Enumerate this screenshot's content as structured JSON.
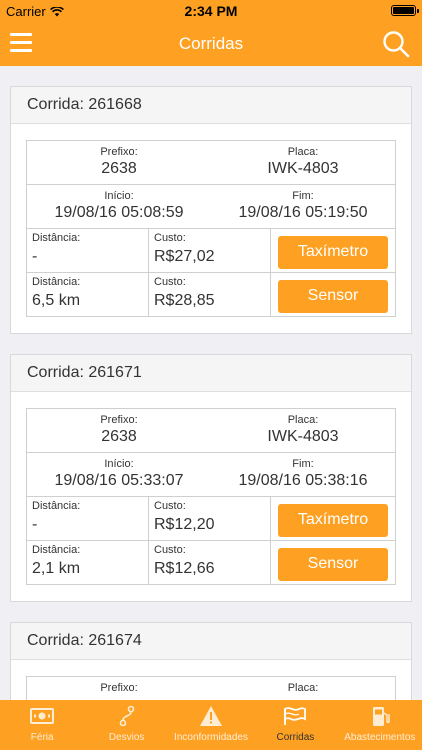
{
  "status_bar": {
    "carrier": "Carrier",
    "time": "2:34 PM"
  },
  "header": {
    "title": "Corridas"
  },
  "labels": {
    "prefixo": "Prefixo:",
    "placa": "Placa:",
    "inicio": "Início:",
    "fim": "Fim:",
    "distancia": "Distância:",
    "custo": "Custo:",
    "taximetro": "Taxímetro",
    "sensor": "Sensor"
  },
  "rides": [
    {
      "title": "Corrida: 261668",
      "prefixo": "2638",
      "placa": "IWK-4803",
      "inicio": "19/08/16 05:08:59",
      "fim": "19/08/16 05:19:50",
      "taximetro": {
        "distancia": "-",
        "custo": "R$27,02"
      },
      "sensor": {
        "distancia": "6,5 km",
        "custo": "R$28,85"
      }
    },
    {
      "title": "Corrida: 261671",
      "prefixo": "2638",
      "placa": "IWK-4803",
      "inicio": "19/08/16 05:33:07",
      "fim": "19/08/16 05:38:16",
      "taximetro": {
        "distancia": "-",
        "custo": "R$12,20"
      },
      "sensor": {
        "distancia": "2,1 km",
        "custo": "R$12,66"
      }
    },
    {
      "title": "Corrida: 261674",
      "prefixo": "",
      "placa": "",
      "inicio": "",
      "fim": "",
      "taximetro": {
        "distancia": "",
        "custo": ""
      },
      "sensor": {
        "distancia": "",
        "custo": ""
      }
    }
  ],
  "tabs": [
    {
      "label": "Féria",
      "icon": "money-icon",
      "active": false
    },
    {
      "label": "Desvios",
      "icon": "route-icon",
      "active": false
    },
    {
      "label": "Inconformidades",
      "icon": "warning-icon",
      "active": false
    },
    {
      "label": "Corridas",
      "icon": "flag-icon",
      "active": true
    },
    {
      "label": "Abastecimentos",
      "icon": "fuel-icon",
      "active": false
    }
  ],
  "colors": {
    "accent": "#fea123",
    "background": "#efeff4"
  }
}
